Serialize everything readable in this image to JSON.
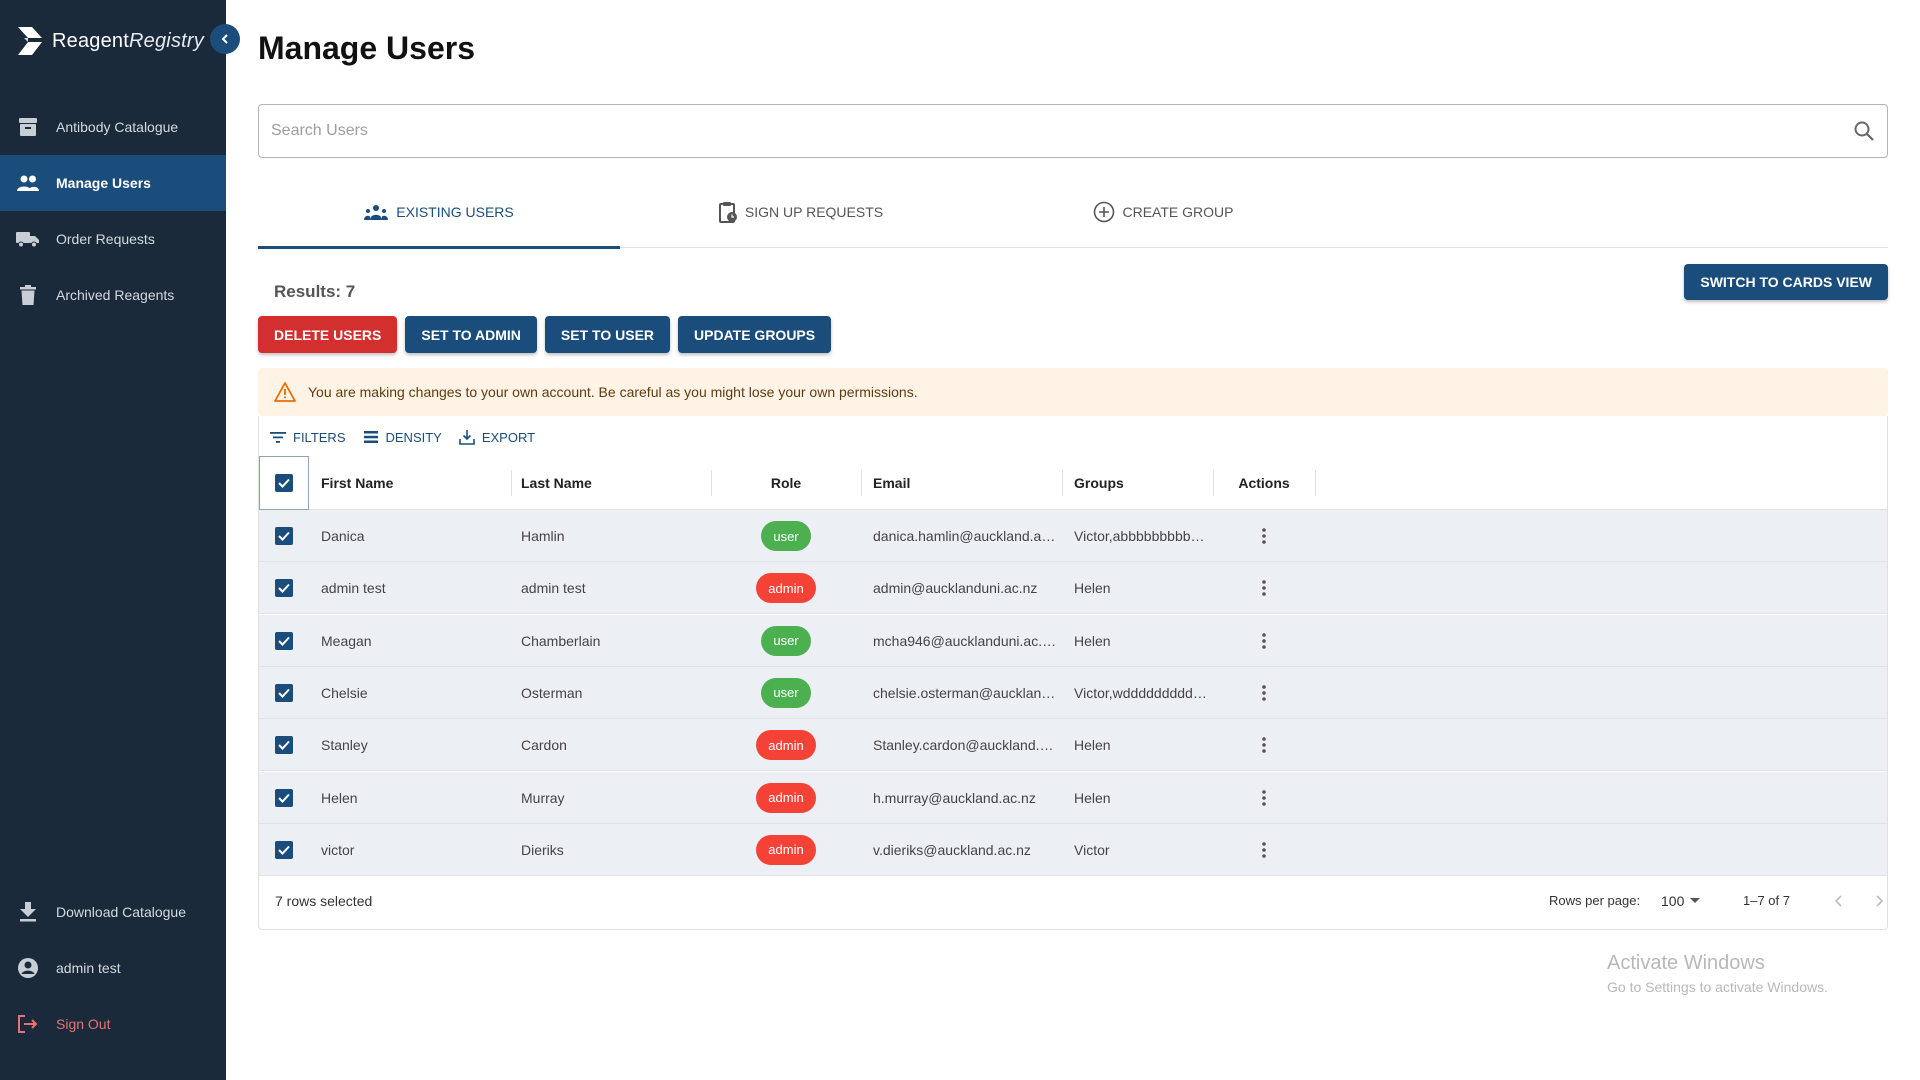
{
  "app": {
    "logo_bold": "Reagent",
    "logo_light": "Registry"
  },
  "sidebar": {
    "items": [
      {
        "label": "Antibody Catalogue",
        "icon": "archive-box-icon",
        "active": false
      },
      {
        "label": "Manage Users",
        "icon": "people-icon",
        "active": true
      },
      {
        "label": "Order Requests",
        "icon": "truck-icon",
        "active": false
      },
      {
        "label": "Archived Reagents",
        "icon": "trash-icon",
        "active": false
      }
    ],
    "bottom_items": [
      {
        "label": "Download Catalogue",
        "icon": "download-icon"
      },
      {
        "label": "admin test",
        "icon": "account-circle-icon"
      },
      {
        "label": "Sign Out",
        "icon": "logout-icon"
      }
    ]
  },
  "page": {
    "title": "Manage Users",
    "search_placeholder": "Search Users",
    "search_value": ""
  },
  "tabs": [
    {
      "label": "Existing Users",
      "icon": "group-add-icon",
      "active": true
    },
    {
      "label": "Sign Up Requests",
      "icon": "clipboard-clock-icon",
      "active": false
    },
    {
      "label": "Create Group",
      "icon": "add-circle-icon",
      "active": false
    }
  ],
  "results_label": "Results: 7",
  "switch_view_label": "SWITCH TO CARDS VIEW",
  "actions": {
    "delete": "DELETE USERS",
    "set_admin": "SET TO ADMIN",
    "set_user": "SET TO USER",
    "update_groups": "UPDATE GROUPS"
  },
  "warning": "You are making changes to your own account. Be careful as you might lose your own permissions.",
  "toolbar": {
    "filters": "Filters",
    "density": "Density",
    "export": "Export"
  },
  "table": {
    "columns": [
      "First Name",
      "Last Name",
      "Role",
      "Email",
      "Groups",
      "Actions"
    ],
    "select_all_checked": true,
    "rows": [
      {
        "first": "Danica",
        "last": "Hamlin",
        "role": "user",
        "email": "danica.hamlin@auckland.a…",
        "groups": "Victor,abbbbbbbbb…",
        "checked": true
      },
      {
        "first": "admin test",
        "last": "admin test",
        "role": "admin",
        "email": "admin@aucklanduni.ac.nz",
        "groups": "Helen",
        "checked": true
      },
      {
        "first": "Meagan",
        "last": "Chamberlain",
        "role": "user",
        "email": "mcha946@aucklanduni.ac.…",
        "groups": "Helen",
        "checked": true
      },
      {
        "first": "Chelsie",
        "last": "Osterman",
        "role": "user",
        "email": "chelsie.osterman@aucklan…",
        "groups": "Victor,wddddddddd…",
        "checked": true
      },
      {
        "first": "Stanley",
        "last": "Cardon",
        "role": "admin",
        "email": "Stanley.cardon@auckland.…",
        "groups": "Helen",
        "checked": true
      },
      {
        "first": "Helen",
        "last": "Murray",
        "role": "admin",
        "email": "h.murray@auckland.ac.nz",
        "groups": "Helen",
        "checked": true
      },
      {
        "first": "victor",
        "last": "Dieriks",
        "role": "admin",
        "email": "v.dieriks@auckland.ac.nz",
        "groups": "Victor",
        "checked": true
      }
    ]
  },
  "footer": {
    "selected": "7 rows selected",
    "rows_per_page_label": "Rows per page:",
    "rows_per_page": "100",
    "range": "1–7 of 7"
  },
  "colors": {
    "sidebar_bg": "#1b2a3a",
    "primary": "#1a4d7c",
    "danger": "#d32f2f",
    "chip_user": "#4caf50",
    "chip_admin": "#f44336",
    "warning_bg": "#fff3e5",
    "warning_icon": "#ed6c02"
  },
  "watermark": {
    "title": "Activate Windows",
    "subtitle": "Go to Settings to activate Windows."
  }
}
